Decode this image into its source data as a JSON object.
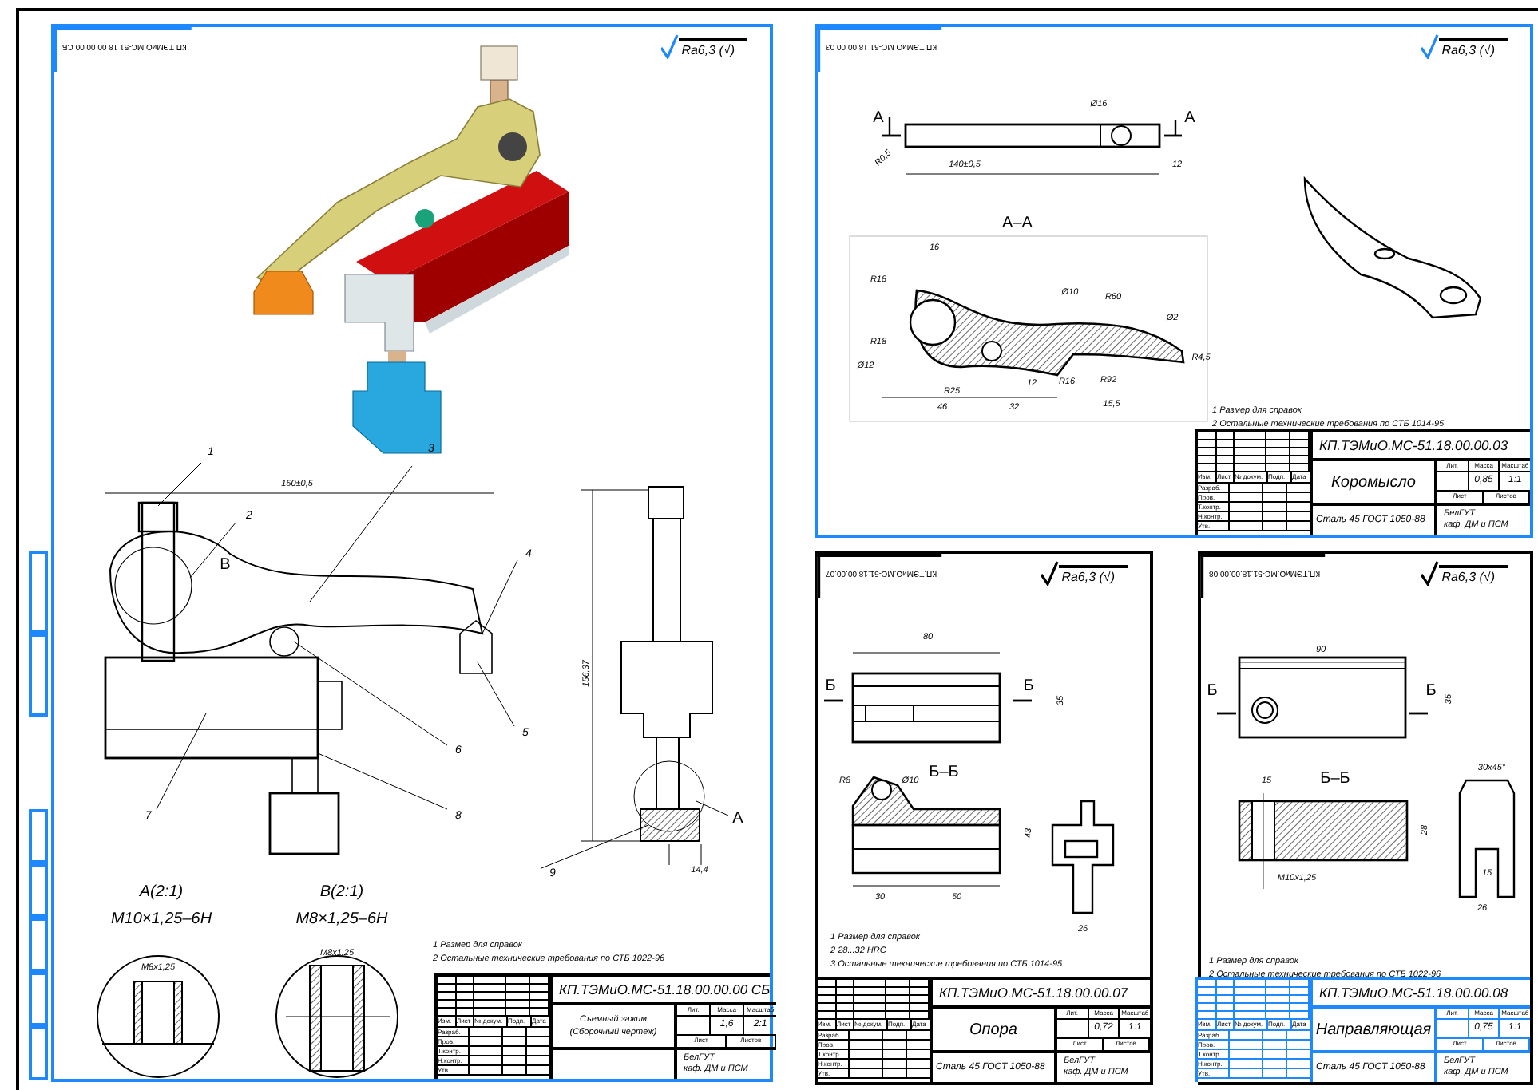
{
  "sheets": [
    {
      "kind": "assembly",
      "selected": true,
      "stamp": "КП.ТЭМиО.МС-51.18.00.00.00 СБ",
      "roughness": "Ra6,3 (√)",
      "labels": [
        {
          "kind": "dimension",
          "text": "150±0,5"
        },
        {
          "kind": "position",
          "text": "1"
        },
        {
          "kind": "position",
          "text": "2"
        },
        {
          "kind": "position",
          "text": "3"
        },
        {
          "kind": "position",
          "text": "4"
        },
        {
          "kind": "position",
          "text": "5"
        },
        {
          "kind": "position",
          "text": "6"
        },
        {
          "kind": "position",
          "text": "7"
        },
        {
          "kind": "position",
          "text": "8"
        },
        {
          "kind": "position",
          "text": "9"
        },
        {
          "kind": "view",
          "text": "B"
        },
        {
          "kind": "view",
          "text": "A"
        },
        {
          "kind": "dimension",
          "text": "156,37"
        },
        {
          "kind": "dimension",
          "text": "14,4"
        },
        {
          "kind": "detail",
          "text": "A(2:1)"
        },
        {
          "kind": "detail",
          "text": "M10×1,25–6H"
        },
        {
          "kind": "detail",
          "text": "B(2:1)"
        },
        {
          "kind": "detail",
          "text": "M8×1,25–6H"
        },
        {
          "kind": "dimension",
          "text": "M8x1,25"
        },
        {
          "kind": "dimension",
          "text": "M8x1,25"
        }
      ],
      "notes": [
        "1 Размер для справок",
        "2 Остальные технические требования по СТБ 1022-96"
      ],
      "title_block": {
        "selected": false,
        "designation": "КП.ТЭМиО.МС-51.18.00.00.00 СБ",
        "name": [
          "Съемный зажим",
          "(Сборочный чертеж)"
        ],
        "mass": "1,6",
        "scale": "2:1",
        "org": [
          "БелГУТ",
          "каф. ДМ и ПСМ"
        ],
        "header": [
          "Изм.",
          "Лист",
          "№ докум.",
          "Подп.",
          "Дата"
        ],
        "roles": [
          "Разраб.",
          "Пров.",
          "Т.контр.",
          "Н.контр.",
          "Утв."
        ],
        "info": [
          "Лит.",
          "Масса",
          "Масштаб"
        ],
        "sheet_labels": [
          "Лист",
          "Листов"
        ]
      }
    },
    {
      "kind": "rocker",
      "selected": true,
      "stamp": "КП.ТЭМиО.МС-51.18.00.00.03",
      "roughness": "Ra6,3 (√)",
      "labels": [
        {
          "kind": "view",
          "text": "A"
        },
        {
          "kind": "view",
          "text": "A"
        },
        {
          "kind": "dimension",
          "text": "Ø16"
        },
        {
          "kind": "dimension",
          "text": "140±0,5"
        },
        {
          "kind": "dimension",
          "text": "12"
        },
        {
          "kind": "dimension",
          "text": "R0,5"
        },
        {
          "kind": "view",
          "text": "A–A"
        },
        {
          "kind": "dimension",
          "text": "16"
        },
        {
          "kind": "dimension",
          "text": "R18"
        },
        {
          "kind": "dimension",
          "text": "R18"
        },
        {
          "kind": "dimension",
          "text": "Ø12"
        },
        {
          "kind": "dimension",
          "text": "R25"
        },
        {
          "kind": "dimension",
          "text": "Ø10"
        },
        {
          "kind": "dimension",
          "text": "R60"
        },
        {
          "kind": "dimension",
          "text": "Ø2"
        },
        {
          "kind": "dimension",
          "text": "R4,5"
        },
        {
          "kind": "dimension",
          "text": "12"
        },
        {
          "kind": "dimension",
          "text": "R16"
        },
        {
          "kind": "dimension",
          "text": "R92"
        },
        {
          "kind": "dimension",
          "text": "46"
        },
        {
          "kind": "dimension",
          "text": "32"
        },
        {
          "kind": "dimension",
          "text": "15,5"
        }
      ],
      "notes": [
        "1 Размер для справок",
        "2 Остальные технические требования по СТБ 1014-95"
      ],
      "title_block": {
        "selected": false,
        "designation": "КП.ТЭМиО.МС-51.18.00.00.03",
        "name": [
          "Коромысло"
        ],
        "material": "Сталь 45 ГОСТ 1050-88",
        "mass": "0,85",
        "scale": "1:1",
        "org": [
          "БелГУТ",
          "каф. ДМ и ПСМ"
        ],
        "header": [
          "Изм.",
          "Лист",
          "№ докум.",
          "Подп.",
          "Дата"
        ],
        "roles": [
          "Разраб.",
          "Пров.",
          "Т.контр.",
          "Н.контр.",
          "Утв."
        ],
        "info": [
          "Лит.",
          "Масса",
          "Масштаб"
        ],
        "sheet_labels": [
          "Лист",
          "Листов"
        ]
      }
    },
    {
      "kind": "support",
      "selected": false,
      "stamp": "КП.ТЭМиО.МС-51.18.00.00.07",
      "roughness": "Ra6,3 (√)",
      "labels": [
        {
          "kind": "dimension",
          "text": "80"
        },
        {
          "kind": "view",
          "text": "Б"
        },
        {
          "kind": "view",
          "text": "Б"
        },
        {
          "kind": "dimension",
          "text": "35"
        },
        {
          "kind": "view",
          "text": "Б–Б"
        },
        {
          "kind": "dimension",
          "text": "R8"
        },
        {
          "kind": "dimension",
          "text": "Ø10"
        },
        {
          "kind": "dimension",
          "text": "30"
        },
        {
          "kind": "dimension",
          "text": "50"
        },
        {
          "kind": "dimension",
          "text": "43"
        },
        {
          "kind": "dimension",
          "text": "26"
        }
      ],
      "notes": [
        "1 Размер для справок",
        "2 28...32 HRC",
        "3 Остальные технические требования по СТБ 1014-95"
      ],
      "title_block": {
        "selected": false,
        "designation": "КП.ТЭМиО.МС-51.18.00.00.07",
        "name": [
          "Опора"
        ],
        "material": "Сталь 45 ГОСТ 1050-88",
        "mass": "0,72",
        "scale": "1:1",
        "org": [
          "БелГУТ",
          "каф. ДМ и ПСМ"
        ],
        "header": [
          "Изм.",
          "Лист",
          "№ докум.",
          "Подп.",
          "Дата"
        ],
        "roles": [
          "Разраб.",
          "Пров.",
          "Т.контр.",
          "Н.контр.",
          "Утв."
        ],
        "info": [
          "Лит.",
          "Масса",
          "Масштаб"
        ],
        "sheet_labels": [
          "Лист",
          "Листов"
        ]
      }
    },
    {
      "kind": "guide",
      "selected": false,
      "stamp": "КП.ТЭМиО.МС-51.18.00.00.08",
      "roughness": "Ra6,3 (√)",
      "labels": [
        {
          "kind": "dimension",
          "text": "90"
        },
        {
          "kind": "view",
          "text": "Б"
        },
        {
          "kind": "view",
          "text": "Б"
        },
        {
          "kind": "dimension",
          "text": "35"
        },
        {
          "kind": "dimension",
          "text": "15"
        },
        {
          "kind": "view",
          "text": "Б–Б"
        },
        {
          "kind": "dimension",
          "text": "30x45°"
        },
        {
          "kind": "dimension",
          "text": "28"
        },
        {
          "kind": "dimension",
          "text": "M10x1,25"
        },
        {
          "kind": "dimension",
          "text": "15"
        },
        {
          "kind": "dimension",
          "text": "26"
        }
      ],
      "notes": [
        "1 Размер для справок",
        "2 Остальные технические требования по СТБ 1022-96"
      ],
      "title_block": {
        "selected": true,
        "designation": "КП.ТЭМиО.МС-51.18.00.00.08",
        "name": [
          "Направляющая"
        ],
        "material": "Сталь 45 ГОСТ 1050-88",
        "mass": "0,75",
        "scale": "1:1",
        "org": [
          "БелГУТ",
          "каф. ДМ и ПСМ"
        ],
        "header": [
          "Изм.",
          "Лист",
          "№ докум.",
          "Подп.",
          "Дата"
        ],
        "roles": [
          "Разраб.",
          "Пров.",
          "Т.контр.",
          "Н.контр.",
          "Утв."
        ],
        "info": [
          "Лит.",
          "Масса",
          "Масштаб"
        ],
        "sheet_labels": [
          "Лист",
          "Листов"
        ]
      }
    }
  ]
}
